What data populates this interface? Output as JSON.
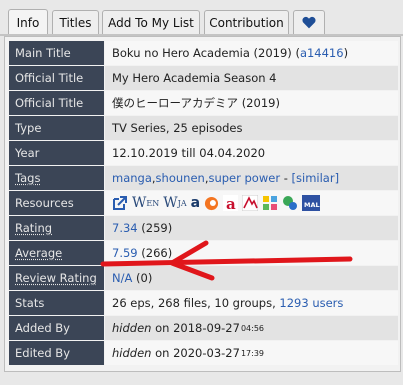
{
  "tabs": [
    {
      "label": "Info"
    },
    {
      "label": "Titles"
    },
    {
      "label": "Add To My List"
    },
    {
      "label": "Contribution"
    },
    {
      "label": "favorite",
      "icon": "heart-icon"
    }
  ],
  "rows": {
    "main_title": {
      "label": "Main Title",
      "value": "Boku no Hero Academia (2019) (",
      "id_link": "a14416",
      "suffix": ")"
    },
    "official_title_1": {
      "label": "Official Title",
      "value": "My Hero Academia Season 4"
    },
    "official_title_2": {
      "label": "Official Title",
      "value": "僕のヒーローアカデミア (2019)"
    },
    "type": {
      "label": "Type",
      "value": "TV Series, 25 episodes"
    },
    "year": {
      "label": "Year",
      "value": "12.10.2019 till 04.04.2020"
    },
    "tags": {
      "label": "Tags",
      "tag1": "manga",
      "tag2": "shounen",
      "tag3": "super power",
      "sep": ", ",
      "dash": " - ",
      "similar": "[similar]"
    },
    "resources": {
      "label": "Resources",
      "icons": [
        "external-link-icon",
        "wikipedia-en-icon",
        "wikipedia-ja-icon",
        "amazon-icon",
        "crunchyroll-icon",
        "animenewsnetwork-icon",
        "anime-planet-icon",
        "allcinema-icon",
        "anisearch-icon",
        "myanimelist-icon"
      ],
      "wen": "EN",
      "wja": "JA",
      "mal": "MAL"
    },
    "rating": {
      "label": "Rating",
      "score": "7.34",
      "votes": " (259)"
    },
    "average": {
      "label": "Average",
      "score": "7.59",
      "votes": " (266)"
    },
    "review_rating": {
      "label": "Review Rating",
      "score": "N/A",
      "votes": " (0)"
    },
    "stats": {
      "label": "Stats",
      "value": "26 eps, 268 files, 10 groups, ",
      "users": "1293 users"
    },
    "added_by": {
      "label": "Added By",
      "user": "hidden",
      "on": " on ",
      "date": "2018-09-27",
      "time": "04:56"
    },
    "edited_by": {
      "label": "Edited By",
      "user": "hidden",
      "on": " on ",
      "date": "2020-03-27",
      "time": "17:39"
    }
  },
  "colors": {
    "label_bg": "#3b4556",
    "link": "#2a5db0",
    "arrow": "#e0161b"
  }
}
